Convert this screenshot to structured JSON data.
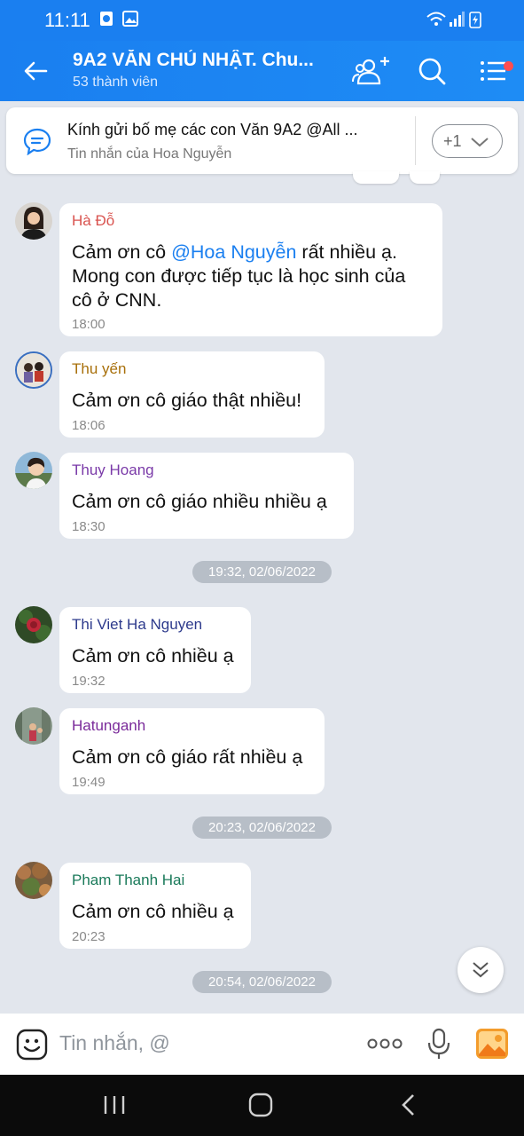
{
  "status_bar": {
    "time": "11:11"
  },
  "header": {
    "title": "9A2 VĂN CHỦ NHẬT. Chu...",
    "subtitle": "53 thành viên"
  },
  "pinned": {
    "title": "Kính gửi bố mẹ các con Văn 9A2 @All ...",
    "subtitle": "Tin nhắn của Hoa Nguyễn",
    "more_label": "+1"
  },
  "messages": [
    {
      "sender": "Hà Đỗ",
      "sender_color": "#d9534f",
      "line1_pre": "Cảm ơn cô ",
      "mention": "@Hoa Nguyễn",
      "line1_post": " rất nhiều ạ.",
      "line2": "Mong con được tiếp tục là học sinh của",
      "line3": "cô ở CNN.",
      "time": "18:00"
    },
    {
      "sender": "Thu yến",
      "sender_color": "#a8700b",
      "text": "Cảm ơn cô giáo thật nhiều!",
      "time": "18:06"
    },
    {
      "sender": "Thuy Hoang",
      "sender_color": "#7a3aa8",
      "text": "Cảm ơn cô giáo nhiều nhiều ạ",
      "time": "18:30"
    },
    {
      "sender": "Thi Viet Ha Nguyen",
      "sender_color": "#2d3a8c",
      "text": "Cảm ơn cô nhiều ạ",
      "time": "19:32"
    },
    {
      "sender": "Hatunganh",
      "sender_color": "#7a2a9a",
      "text": "Cảm ơn cô giáo rất nhiều ạ",
      "time": "19:49"
    },
    {
      "sender": "Pham Thanh Hai",
      "sender_color": "#1a7a5a",
      "text": "Cảm ơn cô nhiều ạ",
      "time": "20:23"
    }
  ],
  "date_separators": [
    "19:32, 02/06/2022",
    "20:23, 02/06/2022",
    "20:54, 02/06/2022"
  ],
  "input": {
    "placeholder": "Tin nhắn, @"
  },
  "colors": {
    "accent": "#1a7ff0",
    "chat_bg": "#e2e6ed",
    "notification_dot": "#ff4d4f"
  }
}
